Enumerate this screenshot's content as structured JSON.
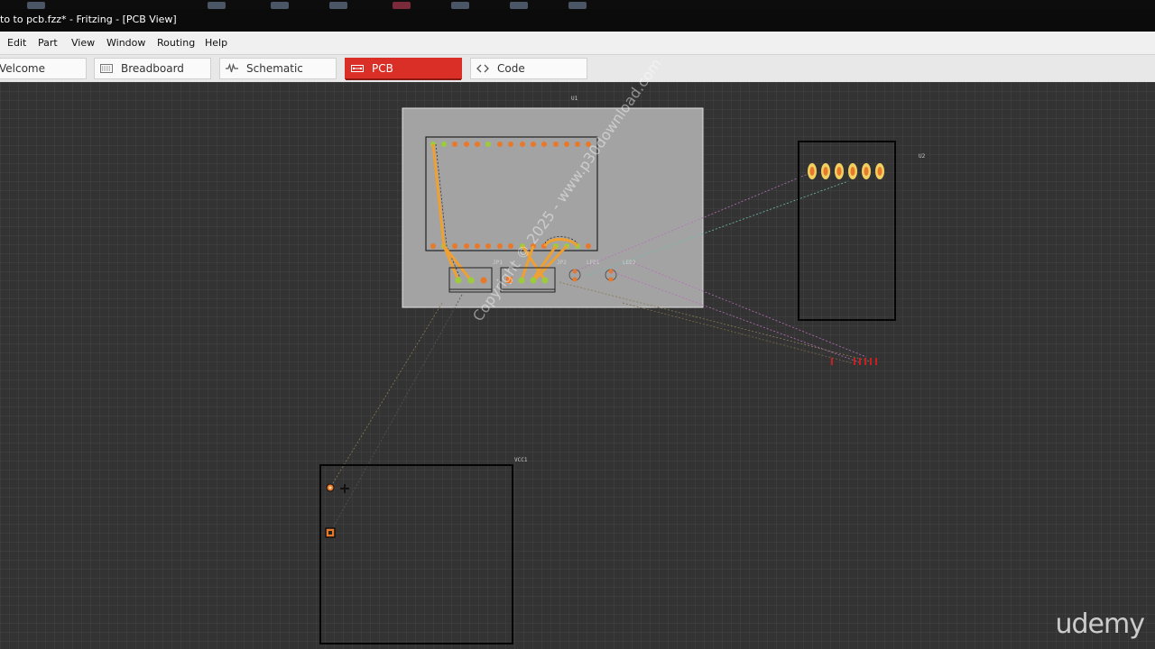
{
  "window": {
    "title": "to to pcb.fzz* - Fritzing - [PCB View]"
  },
  "menu": {
    "items": [
      "Edit",
      "Part",
      "View",
      "Window",
      "Routing",
      "Help"
    ]
  },
  "tabs": [
    {
      "label": "Velcome",
      "icon": "welcome-icon",
      "active": false
    },
    {
      "label": "Breadboard",
      "icon": "breadboard-icon",
      "active": false
    },
    {
      "label": "Schematic",
      "icon": "schematic-icon",
      "active": false
    },
    {
      "label": "PCB",
      "icon": "pcb-icon",
      "active": true
    },
    {
      "label": "Code",
      "icon": "code-icon",
      "active": false
    }
  ],
  "pcb": {
    "parts": {
      "board_label": "U1",
      "header_label": "U2",
      "jp1": "JP1",
      "jp2": "JP2",
      "led1": "LED1",
      "led2": "LED2",
      "battery_label": "VCC1"
    }
  },
  "watermark": "Copyright © 2025 - www.p30download.com",
  "branding": "udemy",
  "colors": {
    "active_tab": "#d92f27",
    "trace": "#f0a030",
    "board": "#a3a3a3"
  }
}
